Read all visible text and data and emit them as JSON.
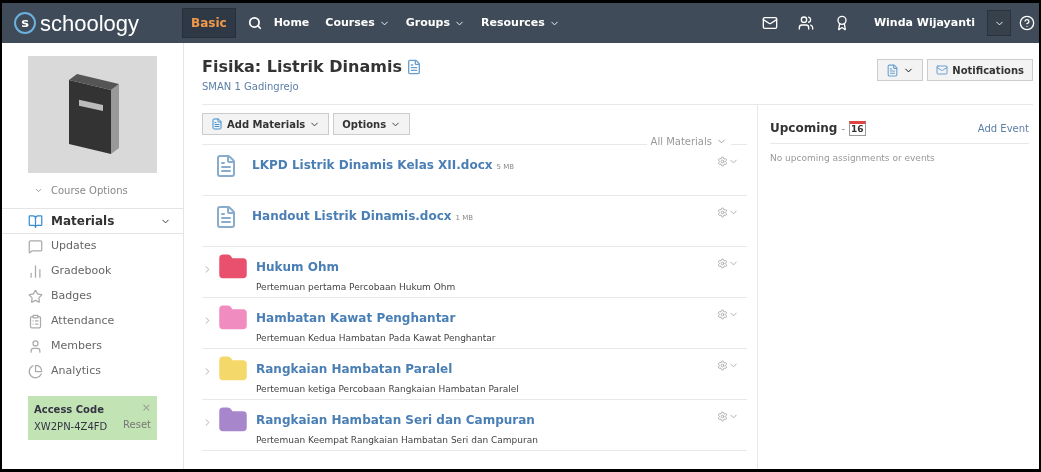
{
  "nav": {
    "logo_mark": "s",
    "logo": "schoology",
    "mode": "Basic",
    "links": [
      {
        "label": "Home",
        "dropdown": false
      },
      {
        "label": "Courses",
        "dropdown": true
      },
      {
        "label": "Groups",
        "dropdown": true
      },
      {
        "label": "Resources",
        "dropdown": true
      }
    ],
    "user": "Winda Wijayanti"
  },
  "sidebar": {
    "course_options": "Course Options",
    "items": [
      {
        "label": "Materials",
        "selected": true
      },
      {
        "label": "Updates",
        "selected": false
      },
      {
        "label": "Gradebook",
        "selected": false
      },
      {
        "label": "Badges",
        "selected": false
      },
      {
        "label": "Attendance",
        "selected": false
      },
      {
        "label": "Members",
        "selected": false
      },
      {
        "label": "Analytics",
        "selected": false
      }
    ],
    "access_code": {
      "title": "Access Code",
      "code": "XW2PN-4Z4FD",
      "close": "×",
      "reset": "Reset"
    }
  },
  "course": {
    "title": "Fisika: Listrik Dinamis",
    "school": "SMAN 1 Gadingrejo",
    "notifications": "Notifications"
  },
  "toolbar": {
    "add_materials": "Add Materials",
    "options": "Options",
    "filter": "All Materials"
  },
  "materials": [
    {
      "kind": "file",
      "title": "LKPD Listrik Dinamis Kelas XII.docx",
      "size": "5 MB"
    },
    {
      "kind": "file",
      "title": "Handout Listrik Dinamis.docx",
      "size": "1 MB"
    },
    {
      "kind": "folder",
      "title": "Hukum Ohm",
      "description": "Pertemuan pertama Percobaan Hukum Ohm",
      "color": "#e8506e"
    },
    {
      "kind": "folder",
      "title": "Hambatan Kawat Penghantar",
      "description": "Pertemuan Kedua Hambatan Pada Kawat Penghantar",
      "color": "#f08cc0"
    },
    {
      "kind": "folder",
      "title": "Rangkaian Hambatan Paralel",
      "description": "Pertemuan ketiga Percobaan Rangkaian Hambatan Paralel",
      "color": "#f5d86a"
    },
    {
      "kind": "folder",
      "title": "Rangkaian Hambatan Seri dan Campuran",
      "description": "Pertemuan Keempat Rangkaian Hambatan Seri dan Campuran",
      "color": "#a886cc"
    }
  ],
  "upcoming": {
    "title": "Upcoming",
    "separator": "-",
    "calendar_day": "16",
    "add_event": "Add Event",
    "empty": "No upcoming assignments or events"
  }
}
